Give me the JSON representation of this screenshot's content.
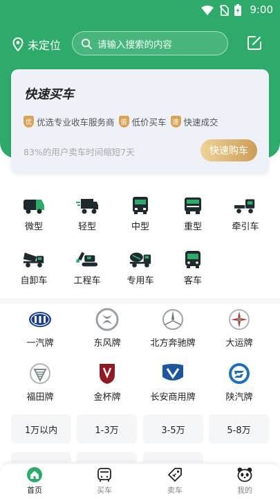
{
  "status": {
    "time": "9:00"
  },
  "header": {
    "location_label": "未定位",
    "search_placeholder": "请输入搜索的内容"
  },
  "quick_buy": {
    "title": "快速买车",
    "features": [
      {
        "badge": "优",
        "label": "优选专业收车服务商"
      },
      {
        "badge": "值",
        "label": "低价买车"
      },
      {
        "badge": "速",
        "label": "快速成交"
      }
    ],
    "stat_text": "83%的用户卖车时间缩短7天",
    "button_label": "快速购车"
  },
  "vehicle_types": [
    "微型",
    "轻型",
    "中型",
    "重型",
    "牵引车",
    "自卸车",
    "工程车",
    "专用车",
    "客车"
  ],
  "brands": [
    "一汽牌",
    "东风牌",
    "北方奔驰牌",
    "大运牌",
    "福田牌",
    "金杯牌",
    "长安商用牌",
    "陕汽牌"
  ],
  "price_ranges": [
    "1万以内",
    "1-3万",
    "3-5万",
    "5-8万"
  ],
  "tabs": [
    {
      "label": "首页",
      "icon": "home-icon",
      "active": true
    },
    {
      "label": "买车",
      "icon": "bus-icon",
      "active": false
    },
    {
      "label": "卖车",
      "icon": "tag-icon",
      "active": false
    },
    {
      "label": "我的",
      "icon": "panda-icon",
      "active": false
    }
  ],
  "colors": {
    "brand_green": "#2eab6a",
    "gold": "#d9a356",
    "card_bg": "#eef1f8"
  }
}
